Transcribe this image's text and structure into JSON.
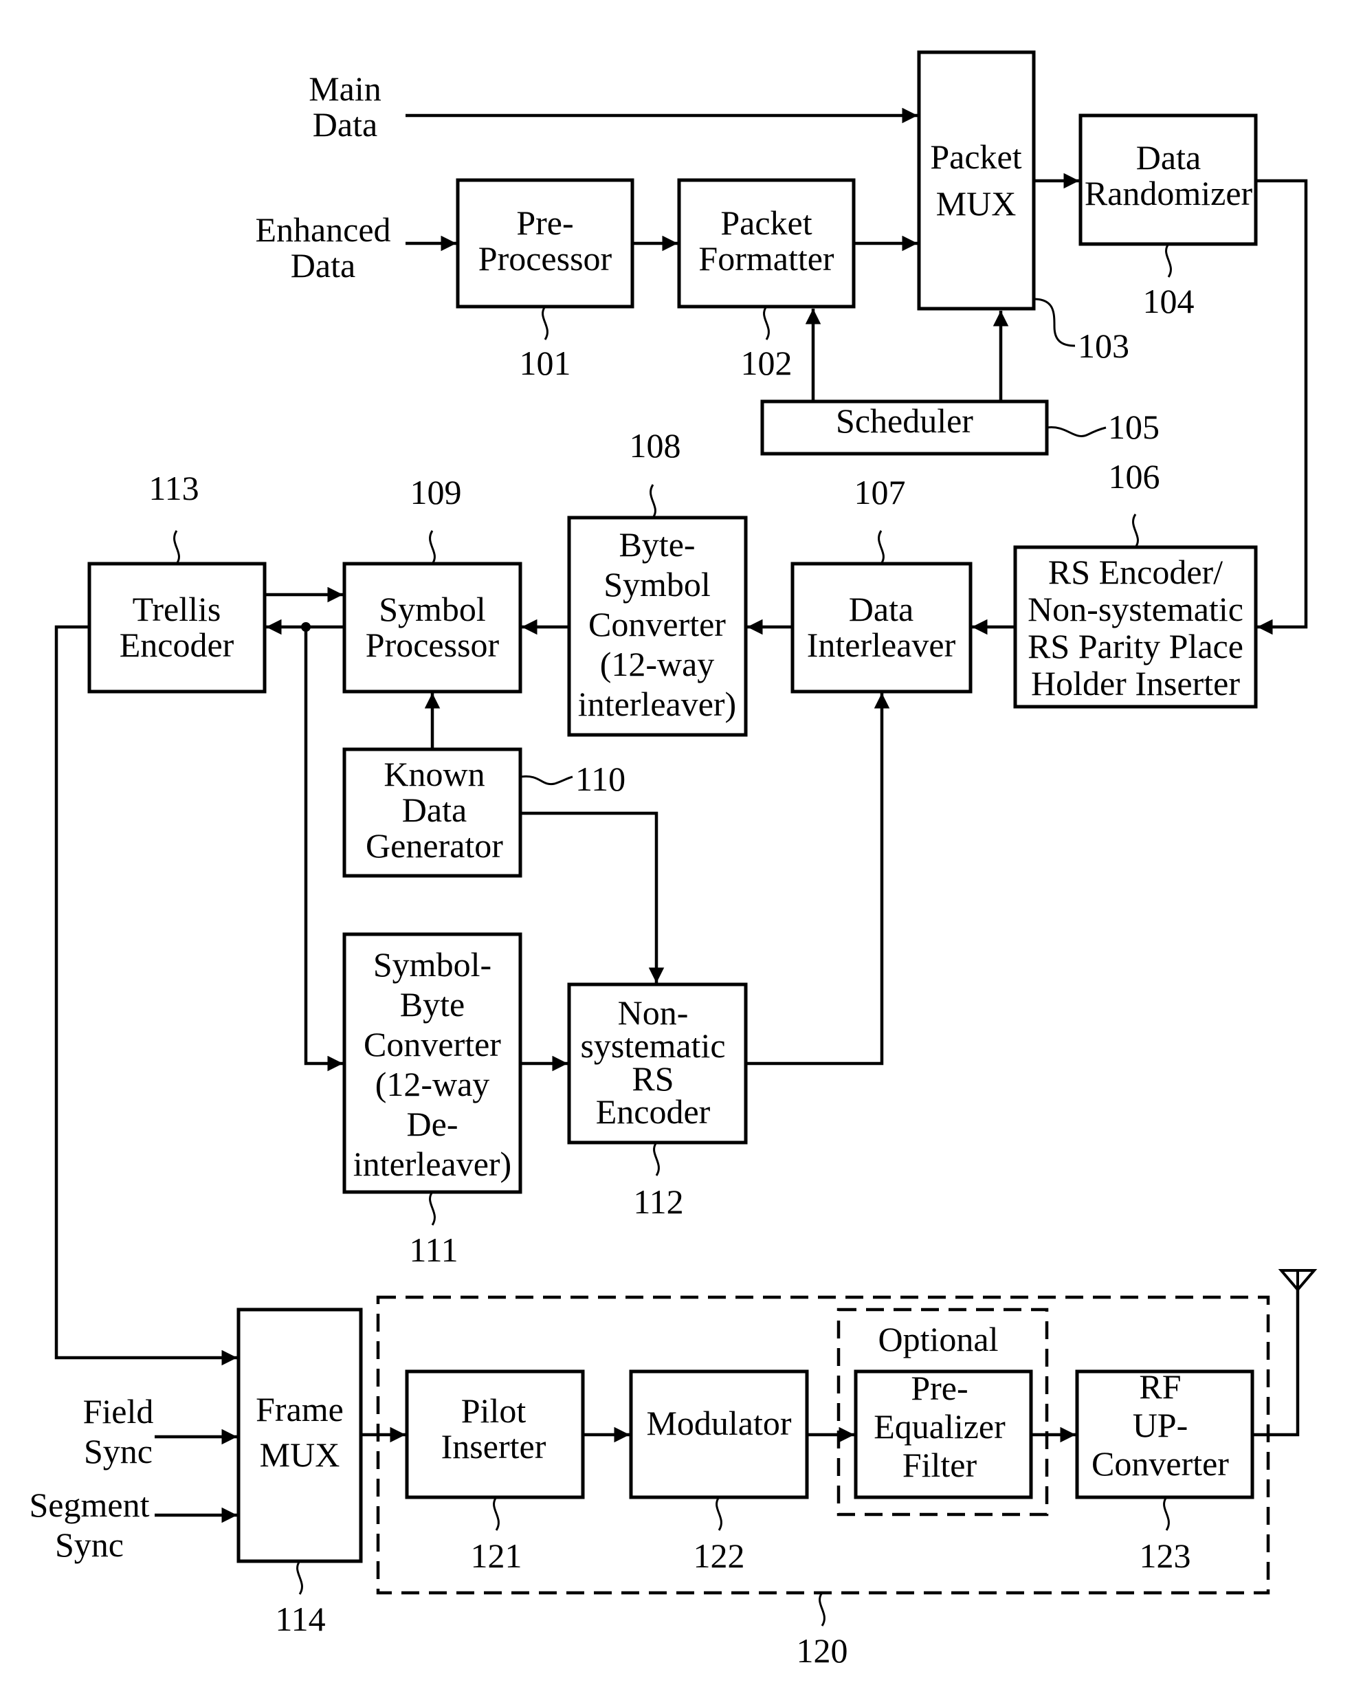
{
  "figure": {
    "inputs": {
      "main_data": [
        "Main",
        "Data"
      ],
      "enhanced_data": [
        "Enhanced",
        "Data"
      ],
      "field_sync": [
        "Field",
        "Sync"
      ],
      "segment_sync": [
        "Segment",
        "Sync"
      ]
    },
    "blocks": {
      "pre_processor": {
        "lines": [
          "Pre-",
          "Processor"
        ],
        "ref": "101"
      },
      "packet_formatter": {
        "lines": [
          "Packet",
          "Formatter"
        ],
        "ref": "102"
      },
      "packet_mux": {
        "lines": [
          "Packet",
          "MUX"
        ],
        "ref": "103"
      },
      "data_randomizer": {
        "lines": [
          "Data",
          "Randomizer"
        ],
        "ref": "104"
      },
      "scheduler": {
        "lines": [
          "Scheduler"
        ],
        "ref": "105"
      },
      "rs_encoder": {
        "lines": [
          "RS Encoder/",
          "Non-systematic",
          "RS Parity Place",
          "Holder Inserter"
        ],
        "ref": "106"
      },
      "data_interleaver": {
        "lines": [
          "Data",
          "Interleaver"
        ],
        "ref": "107"
      },
      "byte_symbol_converter": {
        "lines": [
          "Byte-",
          "Symbol",
          "Converter",
          "(12-way",
          "interleaver)"
        ],
        "ref": "108"
      },
      "symbol_processor": {
        "lines": [
          "Symbol",
          "Processor"
        ],
        "ref": "109"
      },
      "known_data_generator": {
        "lines": [
          "Known",
          "Data",
          "Generator"
        ],
        "ref": "110"
      },
      "symbol_byte_converter": {
        "lines": [
          "Symbol-",
          "Byte",
          "Converter",
          "(12-way",
          "De-",
          "interleaver)"
        ],
        "ref": "111"
      },
      "nonsystematic_rs_encoder": {
        "lines": [
          "Non-",
          "systematic",
          "RS",
          "Encoder"
        ],
        "ref": "112"
      },
      "trellis_encoder": {
        "lines": [
          "Trellis",
          "Encoder"
        ],
        "ref": "113"
      },
      "frame_mux": {
        "lines": [
          "Frame",
          "MUX"
        ],
        "ref": "114"
      },
      "transmitter_group": {
        "ref": "120"
      },
      "pilot_inserter": {
        "lines": [
          "Pilot",
          "Inserter"
        ],
        "ref": "121"
      },
      "modulator": {
        "lines": [
          "Modulator"
        ],
        "ref": "122"
      },
      "optional_group": {
        "label": "Optional"
      },
      "pre_equalizer_filter": {
        "lines": [
          "Pre-",
          "Equalizer",
          "Filter"
        ]
      },
      "rf_up_converter": {
        "lines": [
          "RF",
          "UP-",
          "Converter"
        ],
        "ref": "123"
      }
    },
    "icons": {
      "antenna": "antenna-icon"
    }
  }
}
